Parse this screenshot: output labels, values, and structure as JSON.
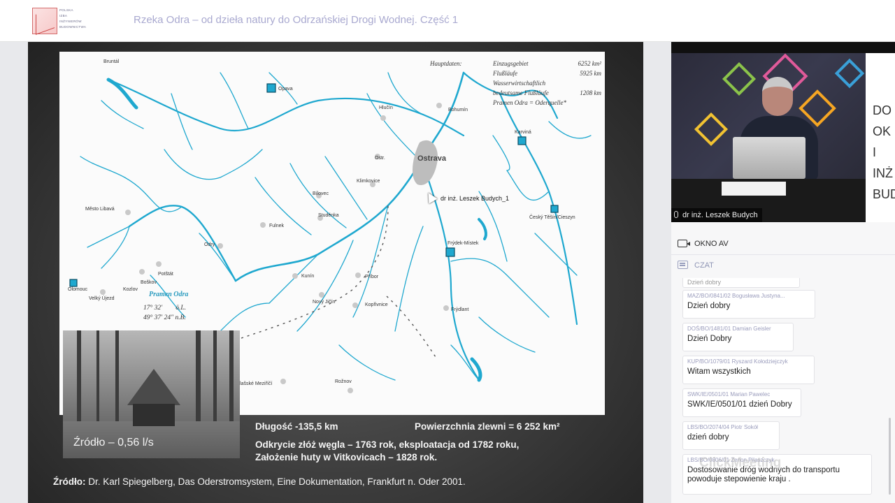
{
  "header": {
    "logo_text": [
      "POLSKA",
      "IZBA",
      "INŻYNIERÓW",
      "BUDOWNICTWA"
    ],
    "title": "Rzeka Odra – od dzieła natury do Odrzańskiej Drogi Wodnej. Część 1"
  },
  "slide": {
    "map_labels": {
      "opava": "Opava",
      "ostrava": "Ostrava",
      "hlucin": "Hlučín",
      "bohumin": "Bohumín",
      "karvina": "Karviná",
      "cesky_tesin": "Český Těšín/Cieszyn",
      "frydek_mistek": "Frýdek-Místek",
      "olomouc": "Olomouc",
      "odry": "Odry",
      "fulnek": "Fulnek",
      "studenka": "Studénka",
      "bilovec": "Bílovec",
      "klimkovice": "Klimkovice",
      "kunin": "Kunín",
      "novy_jicin": "Nový Jičín",
      "pribor": "Příbor",
      "koprivnice": "Kopřivnice",
      "frydlant": "Frýdlant",
      "roznov": "Rožnov",
      "mesto_libava": "Město Libavá",
      "kozlov": "Kozlov",
      "boskov": "Boškov",
      "potstat": "Potštát",
      "velky_ujezd": "Velký Újezd",
      "valasske_mezirici": "Valašské Meziříčí",
      "bruntal": "Bruntál",
      "ostr": "Ostr.",
      "pramen_odra": "Pramen Odra"
    },
    "hauptdaten": {
      "title": "Hauptdaten:",
      "rows": [
        {
          "label": "Einzugsgebiet",
          "value": "6252 km²"
        },
        {
          "label": "Flußläufe",
          "value": "5925 km"
        },
        {
          "label": "Wasserwirtschaftlich",
          "value": ""
        },
        {
          "label": "bedeutsame Flußläufe",
          "value": "1208 km"
        },
        {
          "label": "Pramen Odra = Oderquelle*",
          "value": ""
        }
      ]
    },
    "coords": {
      "line1_deg": "17° 32'",
      "line1_sfx": "ö.L.",
      "line2_deg": "49° 37' 24\"",
      "line2_sfx": "n.B."
    },
    "photo_caption": "Źródło – 0,56 l/s",
    "length": "Długość -135,5 km",
    "basin": "Powierzchnia zlewni = 6 252 km²",
    "coal": "Odkrycie złóż węgla – 1763 rok, eksploatacja od 1782 roku,",
    "steelworks": "Założenie huty w Vitkovicach – 1828 rok.",
    "source_prefix": "Źródło:",
    "source_text": "Dr. Karl Spiegelberg, Das Oderstromsystem, Eine Dokumentation, Frankfurt n. Oder 2001.",
    "cursor_label": "dr inż. Leszek Budych_1"
  },
  "video": {
    "speaker": "dr inż. Leszek Budych",
    "banner_letters": [
      "DO",
      "OK",
      "I",
      "INŻ",
      "BUD"
    ]
  },
  "sections": {
    "av": "OKNO AV",
    "chat": "CZAT"
  },
  "chat": {
    "messages": [
      {
        "author": "",
        "text": "Dzień dobry"
      },
      {
        "author": "MAZ/BO/0841/02 Bogusława Justyna...",
        "text": "Dzień dobry"
      },
      {
        "author": "DOŚ/BO/1481/01 Damian Geisler",
        "text": "Dzień Dobry"
      },
      {
        "author": "KUP/BO/1079/01 Ryszard Kołodziejczyk",
        "text": "Witam wszystkich"
      },
      {
        "author": "SWK/IE/0501/01 Marian Pawelec",
        "text": "SWK/IE/0501/01 dzień Dobry"
      },
      {
        "author": "LBS/BO/2074/04 Piotr Sokół",
        "text": "dzień dobry"
      },
      {
        "author": "LBS/BO/0806/01 Zenon Pilaszczyk",
        "text": "Dostosowanie dróg wodnych do transportu powoduje stepowienie kraju ."
      }
    ]
  },
  "watermark": "ClickMeeting",
  "colors": {
    "river": "#1fa8cf",
    "title_text": "#a9a9d0",
    "chat_author": "#9a9cbc"
  }
}
